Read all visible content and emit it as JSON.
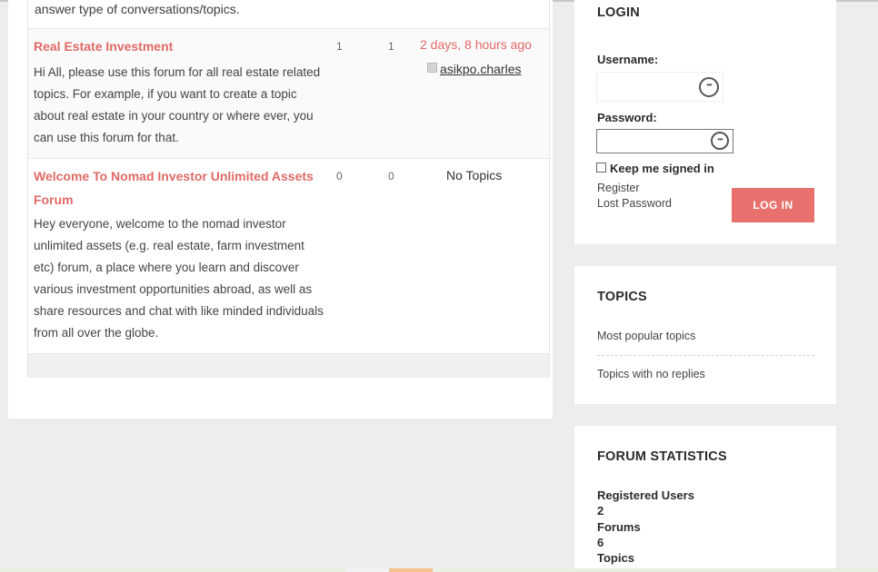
{
  "forum": {
    "intro_tail": "answer type of conversations/topics.",
    "rows": [
      {
        "title": "Real Estate Investment",
        "description": "Hi All, please use this forum for all real estate related topics. For example, if you want to create a topic about real estate in your country or where ever, you can use this forum for that.",
        "topics": "1",
        "posts": "1",
        "freshness": "2 days, 8 hours ago",
        "last_user": "asikpo.charles"
      },
      {
        "title": "Welcome To Nomad Investor Unlimited Assets Forum",
        "description": "Hey everyone, welcome to the nomad investor unlimited assets (e.g. real estate, farm investment etc) forum, a place where you learn and discover various investment opportunities abroad, as well as share resources and chat with like minded individuals from all over the globe.",
        "topics": "0",
        "posts": "0",
        "freshness": "No Topics"
      }
    ]
  },
  "login": {
    "title": "LOGIN",
    "username_label": "Username:",
    "username_value": "",
    "password_label": "Password:",
    "password_value": "",
    "remember_label": "Keep me signed in",
    "remember_checked": false,
    "register_label": "Register",
    "lost_password_label": "Lost Password",
    "button_label": "LOG IN",
    "button_color": "#e8716d"
  },
  "topics_widget": {
    "title": "TOPICS",
    "links": [
      "Most popular topics",
      "Topics with no replies"
    ]
  },
  "stats_widget": {
    "title": "FORUM STATISTICS",
    "items": [
      {
        "label": "Registered Users",
        "value": "2"
      },
      {
        "label": "Forums",
        "value": "6"
      },
      {
        "label": "Topics",
        "value": ""
      }
    ]
  },
  "colors": {
    "accent": "#e06a66",
    "background": "#ededed"
  },
  "icons": {
    "password_manager": "password-manager-icon",
    "avatar": "avatar-placeholder-icon",
    "checkbox": "checkbox-icon"
  }
}
